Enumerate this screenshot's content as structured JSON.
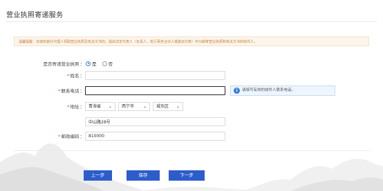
{
  "page": {
    "title": "营业执照寄递服务"
  },
  "notice": {
    "text": "温馨提醒：本接权委托代理人领取营业执照及有关文书的，需由法定代表人（负责人、执行事务合伙人或委派代表）作为邮寄营业执照和有关文书的收件人。"
  },
  "form": {
    "mail_license": {
      "label": "是否寄递营业执照",
      "options": [
        "是",
        "否"
      ],
      "selected": "是"
    },
    "name": {
      "label": "姓名",
      "value": ""
    },
    "phone": {
      "label": "联系电话",
      "value": "",
      "hint": "请填写有效的收件人联系电话。"
    },
    "address": {
      "label": "地址",
      "province": "青海省",
      "city": "西宁市",
      "district": "城东区",
      "detail": "中山路28号"
    },
    "postcode": {
      "label": "邮政编码",
      "value": "810000"
    }
  },
  "buttons": {
    "prev": "上一步",
    "save": "保存",
    "next": "下一步"
  },
  "colors": {
    "primary": "#2d5ccb",
    "required": "#e33333",
    "notice_text": "#c0843c",
    "hint_bg": "#eef5fd"
  }
}
